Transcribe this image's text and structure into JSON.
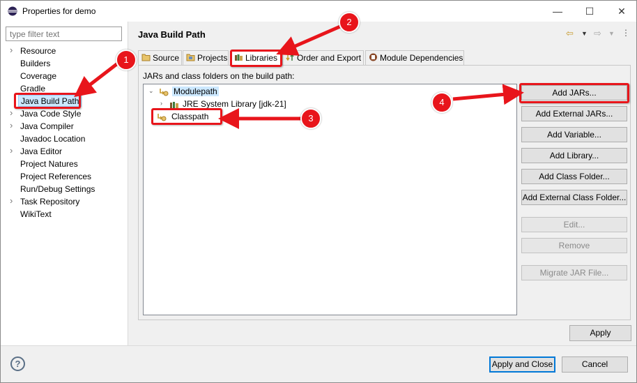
{
  "window": {
    "title": "Properties for demo",
    "minimize": "—",
    "maximize": "☐",
    "close": "✕"
  },
  "filter": {
    "placeholder": "type filter text"
  },
  "sidebar": {
    "items": [
      {
        "label": "Resource",
        "expandable": true
      },
      {
        "label": "Builders",
        "expandable": false
      },
      {
        "label": "Coverage",
        "expandable": false
      },
      {
        "label": "Gradle",
        "expandable": false
      },
      {
        "label": "Java Build Path",
        "expandable": false,
        "selected": true
      },
      {
        "label": "Java Code Style",
        "expandable": true
      },
      {
        "label": "Java Compiler",
        "expandable": true
      },
      {
        "label": "Javadoc Location",
        "expandable": false
      },
      {
        "label": "Java Editor",
        "expandable": true
      },
      {
        "label": "Project Natures",
        "expandable": false
      },
      {
        "label": "Project References",
        "expandable": false
      },
      {
        "label": "Run/Debug Settings",
        "expandable": false
      },
      {
        "label": "Task Repository",
        "expandable": true
      },
      {
        "label": "WikiText",
        "expandable": false
      }
    ]
  },
  "page": {
    "title": "Java Build Path"
  },
  "tabs": [
    {
      "label": "Source",
      "icon": "source-folder-icon"
    },
    {
      "label": "Projects",
      "icon": "projects-icon"
    },
    {
      "label": "Libraries",
      "icon": "libraries-icon",
      "active": true
    },
    {
      "label": "Order and Export",
      "icon": "order-export-icon"
    },
    {
      "label": "Module Dependencies",
      "icon": "module-icon"
    }
  ],
  "libraries": {
    "label": "JARs and class folders on the build path:",
    "tree": [
      {
        "label": "Modulepath",
        "level": 0,
        "expanded": true,
        "selected": true
      },
      {
        "label": "JRE System Library [jdk-21]",
        "level": 1,
        "expanded": false
      },
      {
        "label": "Classpath",
        "level": 0
      }
    ]
  },
  "buttons": {
    "add_jars": "Add JARs...",
    "add_external_jars": "Add External JARs...",
    "add_variable": "Add Variable...",
    "add_library": "Add Library...",
    "add_class_folder": "Add Class Folder...",
    "add_external_class_folder": "Add External Class Folder...",
    "edit": "Edit...",
    "remove": "Remove",
    "migrate_jar": "Migrate JAR File...",
    "apply": "Apply",
    "apply_and_close": "Apply and Close",
    "cancel": "Cancel",
    "help": "?"
  },
  "annotations": {
    "badges": [
      "1",
      "2",
      "3",
      "4"
    ],
    "color": "#e8151b"
  }
}
